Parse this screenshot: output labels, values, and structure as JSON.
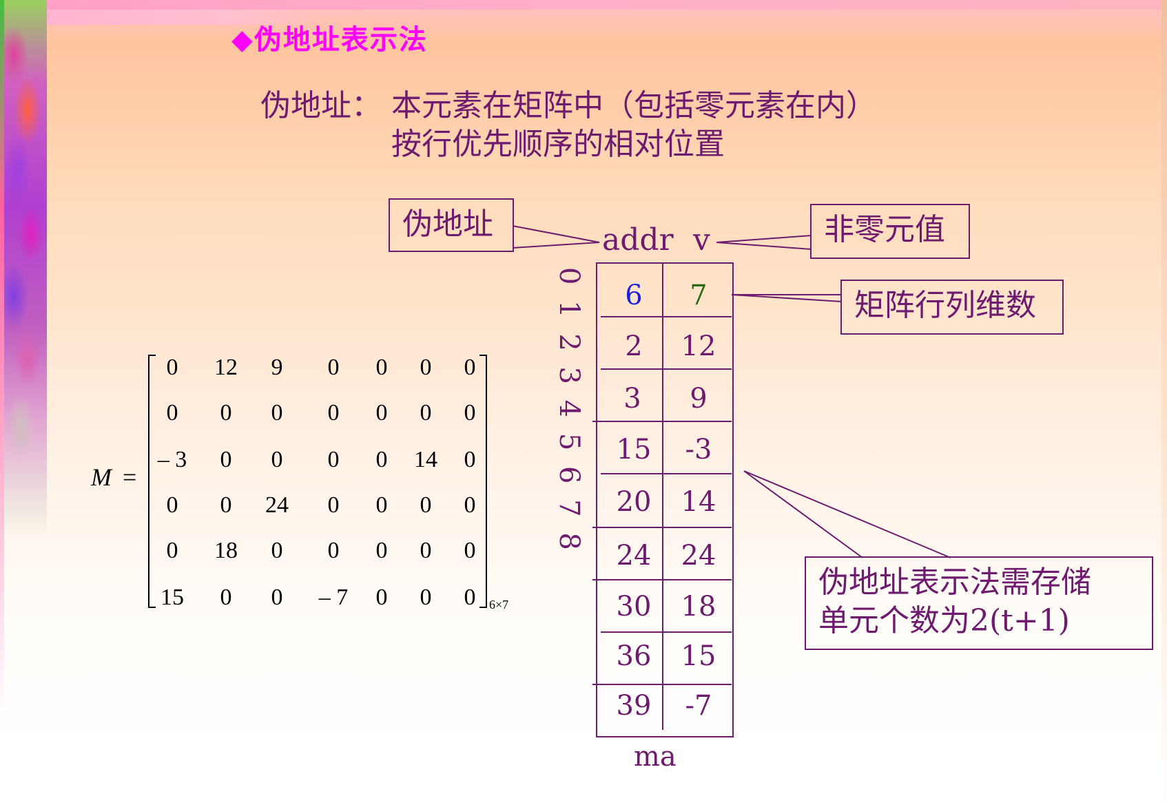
{
  "slide": {
    "title": "◆伪地址表示法",
    "definition": {
      "term": "伪地址：",
      "line1": "本元素在矩阵中（包括零元素在内）",
      "line2": "按行优先顺序的相对位置"
    }
  },
  "callouts": {
    "pseudo_address": "伪地址",
    "nonzero_value": "非零元值",
    "matrix_dims": "矩阵行列维数",
    "storage_note_line1": "伪地址表示法需存储",
    "storage_note_line2": "单元个数为2(t+1)"
  },
  "table": {
    "header_addr": "addr",
    "header_v": "v",
    "name": "ma",
    "index_labels": "0 1 2 3 4 5 6 7 8",
    "rows": [
      {
        "addr": "6",
        "v": "7"
      },
      {
        "addr": "2",
        "v": "12"
      },
      {
        "addr": "3",
        "v": "9"
      },
      {
        "addr": "15",
        "v": "-3"
      },
      {
        "addr": "20",
        "v": "14"
      },
      {
        "addr": "24",
        "v": "24"
      },
      {
        "addr": "30",
        "v": "18"
      },
      {
        "addr": "36",
        "v": "15"
      },
      {
        "addr": "39",
        "v": "-7"
      }
    ],
    "colors": {
      "first_addr": "#1f1fe0",
      "first_v": "#2a6a10",
      "text": "#6e1a6e"
    }
  },
  "matrix": {
    "label": "M",
    "equals": "=",
    "subscript": "6×7",
    "rows": [
      [
        "0",
        "12",
        "9",
        "0",
        "0",
        "0",
        "0"
      ],
      [
        "0",
        "0",
        "0",
        "0",
        "0",
        "0",
        "0"
      ],
      [
        "– 3",
        "0",
        "0",
        "0",
        "0",
        "14",
        "0"
      ],
      [
        "0",
        "0",
        "24",
        "0",
        "0",
        "0",
        "0"
      ],
      [
        "0",
        "18",
        "0",
        "0",
        "0",
        "0",
        "0"
      ],
      [
        "15",
        "0",
        "0",
        "– 7",
        "0",
        "0",
        "0"
      ]
    ]
  }
}
